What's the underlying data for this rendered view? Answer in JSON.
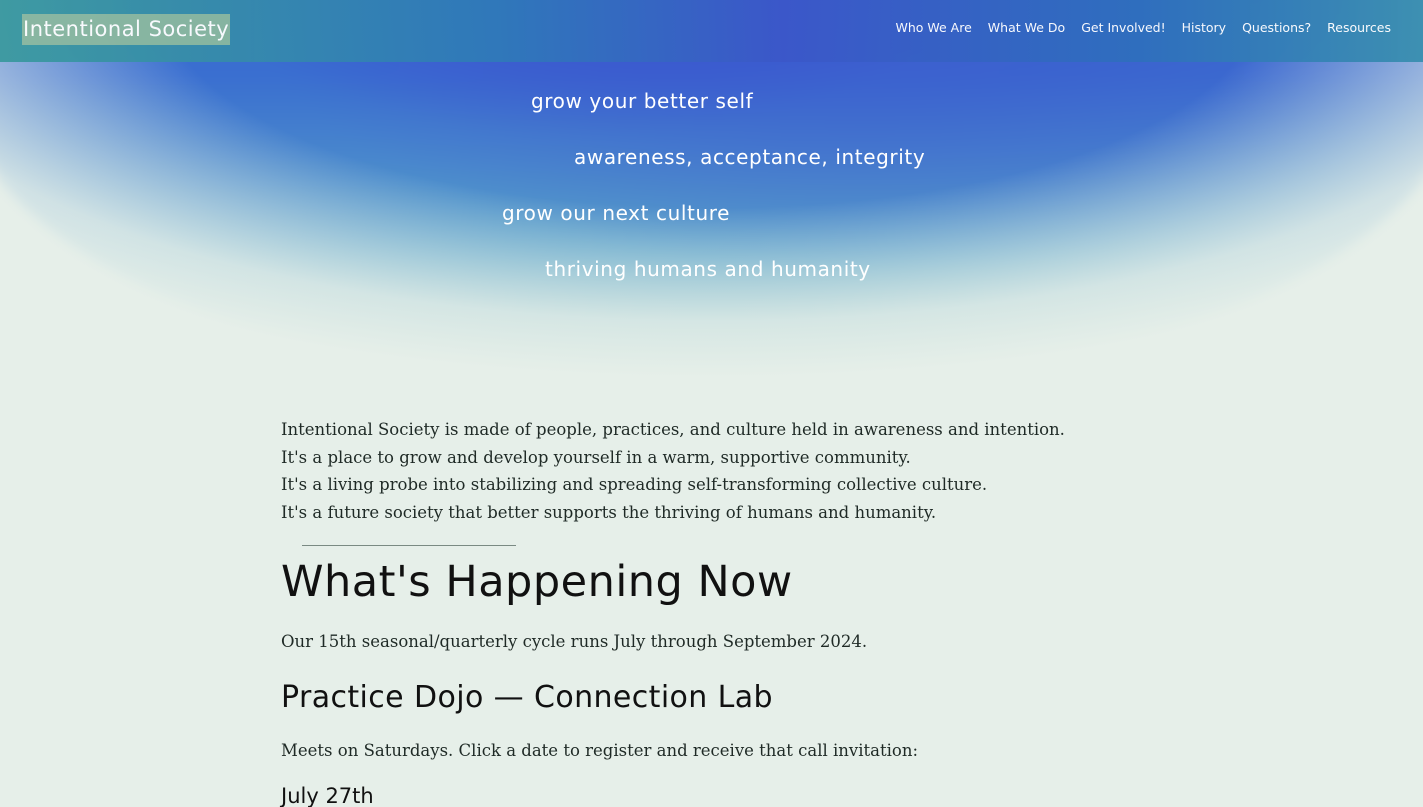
{
  "site": {
    "logo_text": "Intentional Society"
  },
  "nav": {
    "items": [
      {
        "label": "Who We Are"
      },
      {
        "label": "What We Do"
      },
      {
        "label": "Get Involved!"
      },
      {
        "label": "History"
      },
      {
        "label": "Questions?"
      },
      {
        "label": "Resources"
      }
    ]
  },
  "hero": {
    "lines": [
      "grow your better self",
      "awareness, acceptance, integrity",
      "grow our next culture",
      "thriving humans and humanity"
    ]
  },
  "intro": {
    "paragraphs": [
      "Intentional Society is made of people, practices, and culture held in awareness and intention.",
      "It's a place to grow and develop yourself in a warm, supportive community.",
      "It's a living probe into stabilizing and spreading self-transforming collective culture.",
      "It's a future society that better supports the thriving of humans and humanity."
    ]
  },
  "happening": {
    "heading": "What's Happening Now",
    "cycle_text": "Our 15th seasonal/quarterly cycle runs July through September 2024.",
    "dojo_heading": "Practice Dojo — Connection Lab",
    "meets_text": "Meets on Saturdays. Click a date to register and receive that call invitation:",
    "dates": [
      "July 27th"
    ]
  },
  "colors": {
    "topbar_accent": "#3b57c9",
    "background": "#e6efe9",
    "hero_blue": "#3a45d0",
    "text": "#1f2a26"
  }
}
